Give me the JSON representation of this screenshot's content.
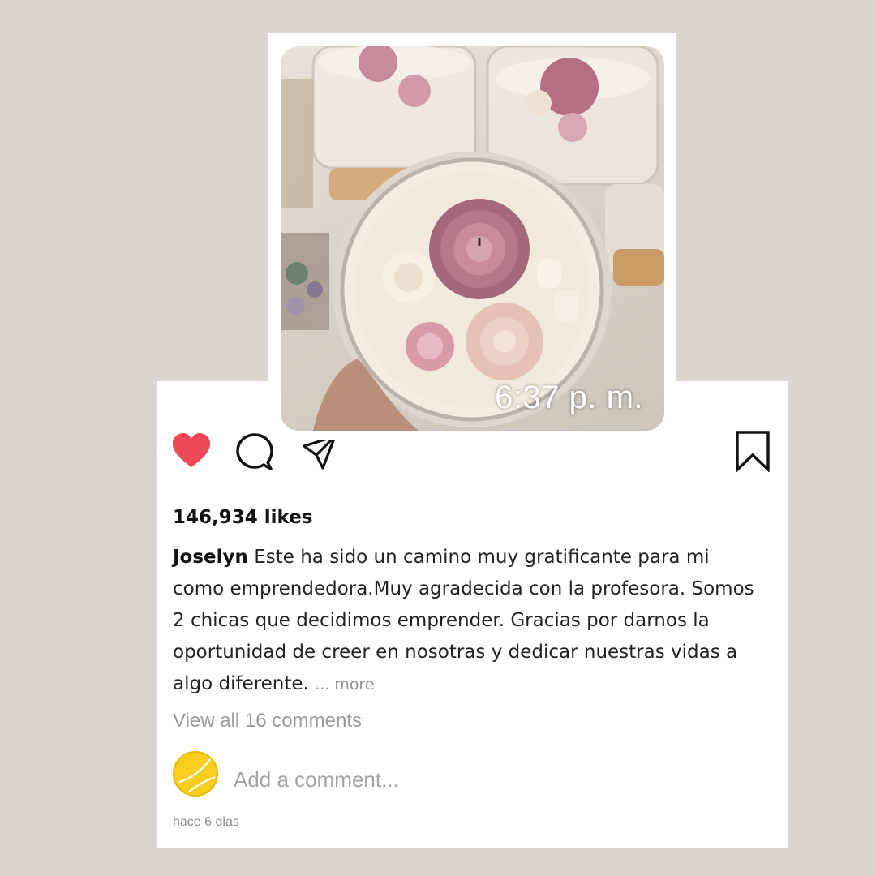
{
  "post": {
    "image_time": "6:37 p. m.",
    "likes": "146,934 likes",
    "username": "Joselyn",
    "caption": "Este ha sido un camino muy gratificante para mi como emprendedora.Muy agradecida con la profesora. Somos 2 chicas que decidimos emprender. Gracias por darnos la oportunidad de creer en nosotras y dedicar nuestras vidas a algo diferente.",
    "more_label": "... more",
    "view_comments": "View all 16 comments",
    "comment_placeholder": "Add a comment...",
    "timestamp": "hace 6 dias"
  },
  "icons": {
    "like": "heart-icon",
    "comment": "comment-bubble-icon",
    "share": "paper-plane-icon",
    "save": "bookmark-icon"
  },
  "colors": {
    "background": "#dad5cf",
    "like_active": "#ed4956",
    "avatar": "#f7cd1e"
  }
}
